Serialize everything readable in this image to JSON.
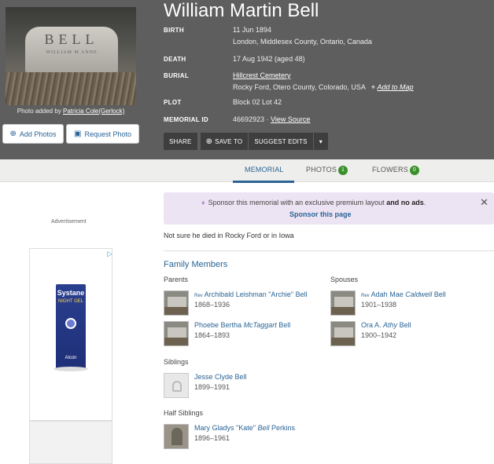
{
  "memorial": {
    "name": "William Martin Bell",
    "facts": [
      {
        "key": "BIRTH",
        "line1": "11 Jun 1894",
        "line2": "London, Middlesex County, Ontario, Canada"
      },
      {
        "key": "DEATH",
        "line1": "17 Aug 1942 (aged 48)"
      },
      {
        "key": "BURIAL",
        "line1": "Hillcrest Cemetery",
        "line2": "Rocky Ford, Otero County, Colorado, USA",
        "map_link": "Add to Map"
      },
      {
        "key": "PLOT",
        "line1": "Block 02 Lot 42"
      },
      {
        "key": "MEMORIAL ID",
        "line1": "46692923",
        "link": "View Source"
      }
    ]
  },
  "photo": {
    "stone_text": "BELL",
    "stone_sub": "WILLIAM M   ANNE",
    "credit_prefix": "Photo added by",
    "credit_name": "Patricia Cole(Gerlock)"
  },
  "buttons": {
    "add_photos": "Add Photos",
    "request_photo": "Request Photo",
    "share": "SHARE",
    "save_to": "SAVE TO",
    "suggest_edits": "SUGGEST EDITS",
    "more": "▾"
  },
  "tabs": [
    {
      "label": "MEMORIAL"
    },
    {
      "label": "PHOTOS",
      "count": "1"
    },
    {
      "label": "FLOWERS",
      "count": "0"
    }
  ],
  "ad": {
    "label": "Advertisement",
    "brand": "Systane",
    "product": "NIGHT GEL",
    "maker": "Alcon"
  },
  "sponsor": {
    "text_a": "Sponsor this memorial with an exclusive premium layout",
    "text_b": "and no ads",
    "text_c": ".",
    "link": "Sponsor this page",
    "close": "✕"
  },
  "note": "Not sure he died in Rocky Ford or in Iowa",
  "family": {
    "title": "Family Members",
    "parents_label": "Parents",
    "spouses_label": "Spouses",
    "siblings_label": "Siblings",
    "half_siblings_label": "Half Siblings",
    "parents": [
      {
        "prefix": "Rev",
        "name": "Archibald Leishman \"Archie\" Bell",
        "dates": "1868–1936"
      },
      {
        "first": "Phoebe Bertha",
        "maiden": "McTaggart",
        "last": "Bell",
        "dates": "1864–1893"
      }
    ],
    "spouses": [
      {
        "prefix": "Rev",
        "first": "Adah Mae",
        "maiden": "Caldwell",
        "last": "Bell",
        "dates": "1901–1938"
      },
      {
        "first": "Ora A.",
        "maiden": "Athy",
        "last": "Bell",
        "dates": "1900–1942"
      }
    ],
    "siblings": [
      {
        "name": "Jesse Clyde Bell",
        "dates": "1899–1991"
      }
    ],
    "half_siblings": [
      {
        "first": "Mary Gladys \"Kate\"",
        "maiden": "Bell",
        "last": "Perkins",
        "dates": "1896–1961"
      }
    ]
  }
}
